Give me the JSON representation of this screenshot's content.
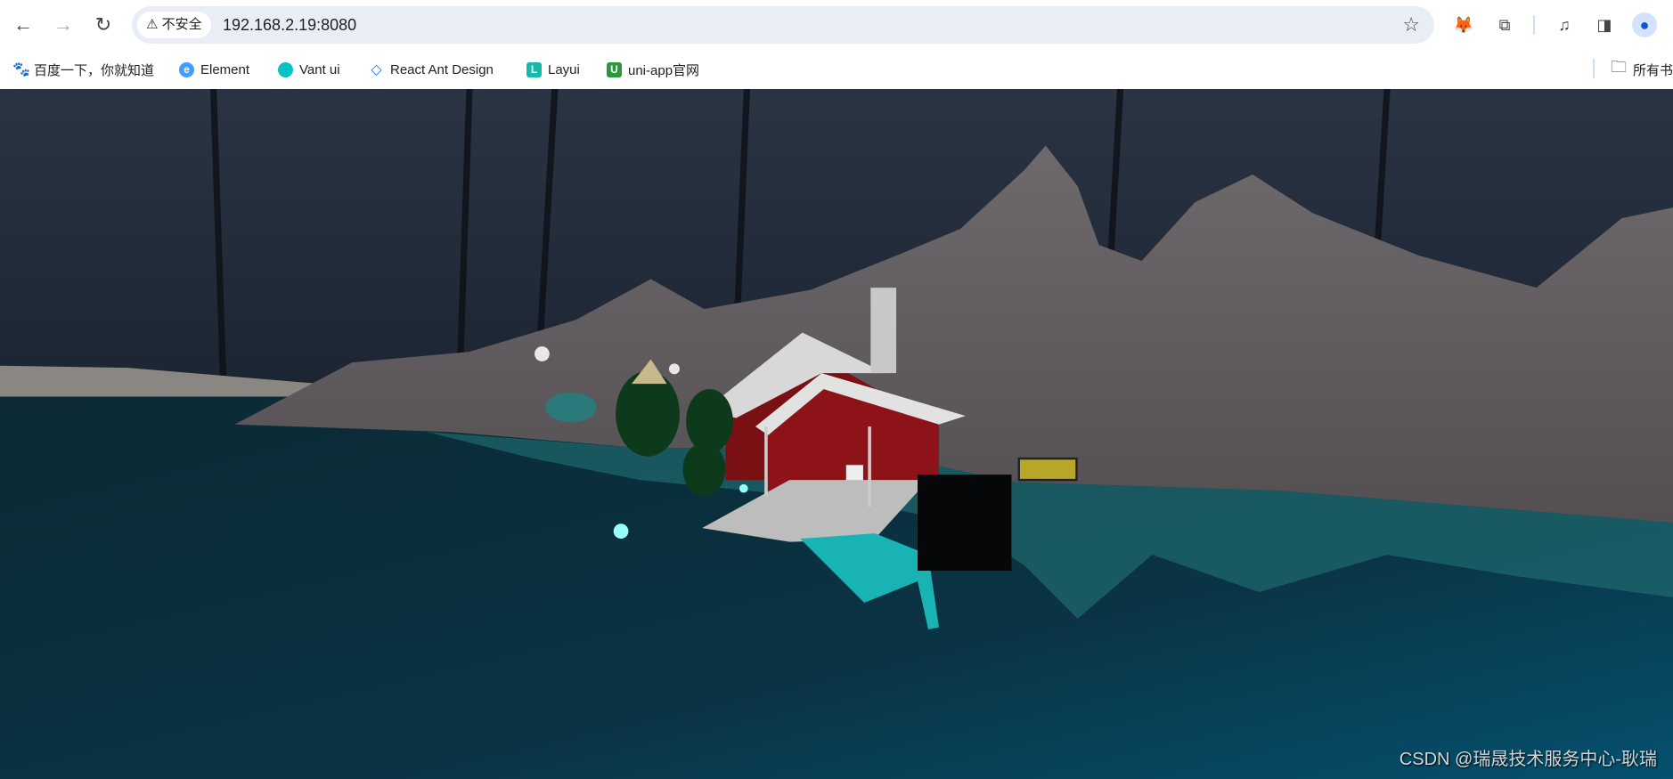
{
  "browser": {
    "security_label": "不安全",
    "url": "192.168.2.19:8080",
    "icons": [
      "back-icon",
      "forward-icon",
      "reload-icon",
      "warning-icon",
      "star-icon",
      "metamask-icon",
      "extensions-icon",
      "media-icon",
      "side-panel-icon",
      "profile-icon"
    ]
  },
  "bookmarks": {
    "items": [
      {
        "label": "百度一下，你就知道",
        "icon": "baidu-icon",
        "color": "#2932e1"
      },
      {
        "label": "Element",
        "icon": "element-icon",
        "color": "#409eff"
      },
      {
        "label": "Vant ui",
        "icon": "vant-icon",
        "color": "#07c2c2"
      },
      {
        "label": "React Ant Design",
        "icon": "antd-icon",
        "color": "#1677ff"
      },
      {
        "label": "Layui",
        "icon": "layui-icon",
        "color": "#16baaa"
      },
      {
        "label": "uni-app官网",
        "icon": "uniapp-icon",
        "color": "#2b9939"
      }
    ],
    "all_bookmarks": "所有书签"
  },
  "scene": {
    "watermark": "CSDN @瑞晟技术服务中心-耿瑞"
  }
}
